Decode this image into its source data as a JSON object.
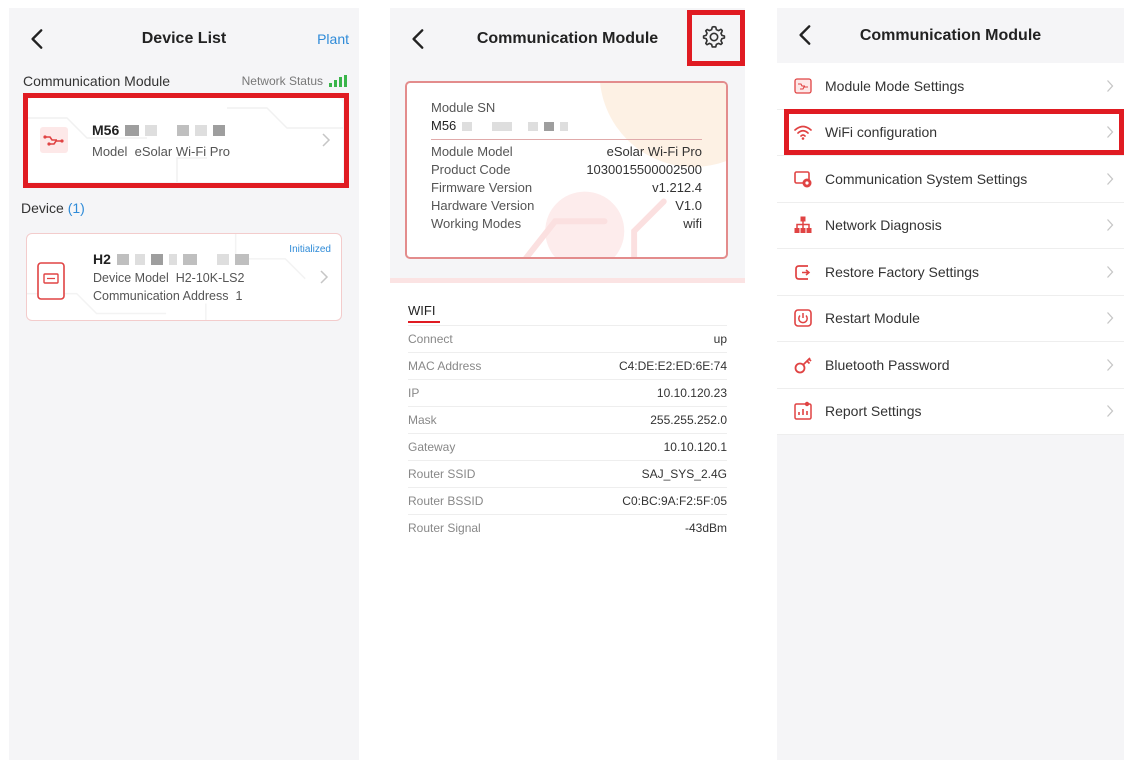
{
  "screen1": {
    "title": "Device List",
    "right_link": "Plant",
    "comm_section_label": "Communication Module",
    "network_status_label": "Network Status",
    "module_card": {
      "sn_prefix": "M56",
      "model_label": "Model",
      "model_value": "eSolar Wi-Fi Pro"
    },
    "device_section_label": "Device",
    "device_count": "(1)",
    "device_card": {
      "sn_prefix": "H2",
      "status_badge": "Initialized",
      "model_label": "Device Model",
      "model_value": "H2-10K-LS2",
      "address_label": "Communication Address",
      "address_value": "1"
    }
  },
  "screen2": {
    "title": "Communication Module",
    "module_sn_label": "Module SN",
    "module_sn_prefix": "M56",
    "info": [
      {
        "label": "Module Model",
        "value": "eSolar Wi-Fi Pro"
      },
      {
        "label": "Product Code",
        "value": "1030015500002500"
      },
      {
        "label": "Firmware Version",
        "value": "v1.212.4"
      },
      {
        "label": "Hardware Version",
        "value": "V1.0"
      },
      {
        "label": "Working Modes",
        "value": "wifi"
      }
    ],
    "wifi_title": "WIFI",
    "wifi_rows": [
      {
        "label": "Connect",
        "value": "up"
      },
      {
        "label": "MAC Address",
        "value": "C4:DE:E2:ED:6E:74"
      },
      {
        "label": "IP",
        "value": "10.10.120.23"
      },
      {
        "label": "Mask",
        "value": "255.255.252.0"
      },
      {
        "label": "Gateway",
        "value": "10.10.120.1"
      },
      {
        "label": "Router SSID",
        "value": "SAJ_SYS_2.4G"
      },
      {
        "label": "Router BSSID",
        "value": "C0:BC:9A:F2:5F:05"
      },
      {
        "label": "Router Signal",
        "value": "-43dBm"
      }
    ]
  },
  "screen3": {
    "title": "Communication Module",
    "menu": [
      {
        "label": "Module Mode Settings",
        "icon": "module-mode-icon"
      },
      {
        "label": "WiFi configuration",
        "icon": "wifi-icon"
      },
      {
        "label": "Communication System Settings",
        "icon": "comm-system-icon"
      },
      {
        "label": "Network Diagnosis",
        "icon": "network-icon"
      },
      {
        "label": "Restore Factory Settings",
        "icon": "restore-icon"
      },
      {
        "label": "Restart Module",
        "icon": "restart-icon"
      },
      {
        "label": "Bluetooth Password",
        "icon": "key-icon"
      },
      {
        "label": "Report Settings",
        "icon": "report-icon"
      }
    ]
  },
  "colors": {
    "accent_red": "#e01b22",
    "link_blue": "#2f8bd8",
    "signal_green": "#3ab54a"
  }
}
